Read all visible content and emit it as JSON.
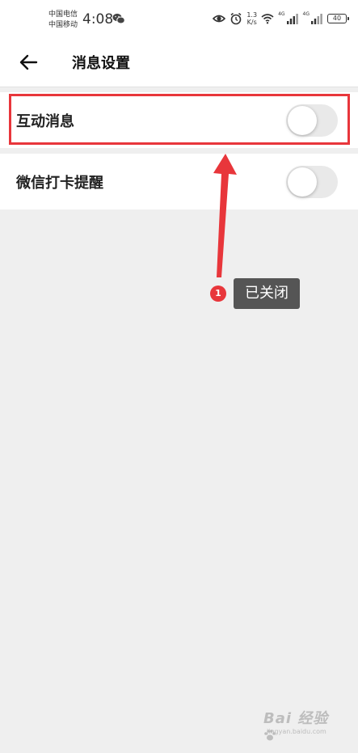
{
  "status_bar": {
    "carrier_1": "中国电信",
    "carrier_2": "中国移动",
    "time": "4:08",
    "net_speed_value": "1.3",
    "net_speed_unit": "K/s",
    "signal_1_label": "4G",
    "signal_2_label": "4G",
    "battery_level": "40",
    "icons": [
      "wechat-icon",
      "eye-icon",
      "alarm-icon",
      "wifi-icon",
      "signal-icon",
      "battery-icon"
    ]
  },
  "header": {
    "title": "消息设置",
    "back_icon": "back-arrow-icon"
  },
  "settings": [
    {
      "label": "互动消息",
      "enabled": false
    },
    {
      "label": "微信打卡提醒",
      "enabled": false
    }
  ],
  "annotation": {
    "badge_number": "1",
    "callout_text": "已关闭",
    "color": "#e8363b"
  },
  "watermark": {
    "main": "Bai 经验",
    "sub": "jingyan.baidu.com"
  },
  "colors": {
    "background": "#efefef",
    "surface": "#ffffff",
    "toggle_off_track": "#e9e9e9",
    "annotation_red": "#e8363b",
    "callout_bg": "#555555"
  }
}
